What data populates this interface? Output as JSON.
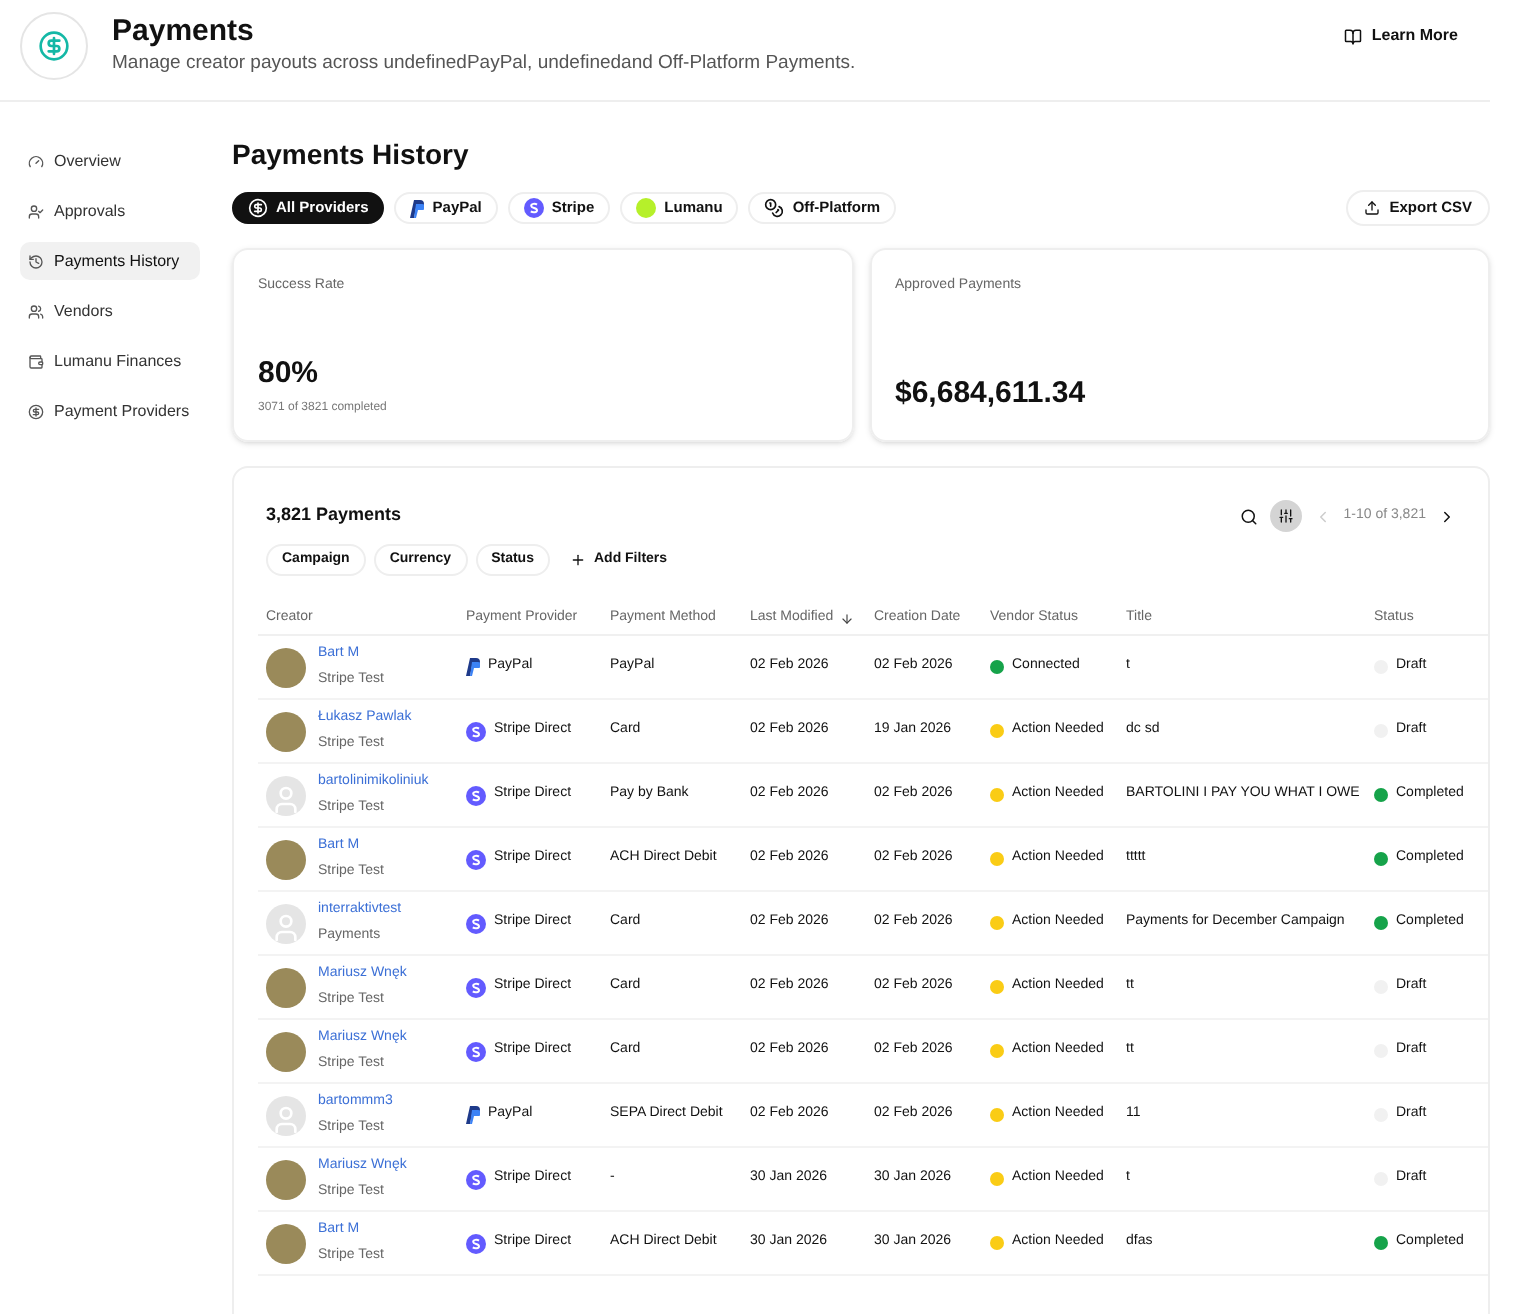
{
  "header": {
    "title": "Payments",
    "subtitle": "Manage creator payouts across undefinedPayPal, undefinedand Off-Platform Payments.",
    "learn_more": "Learn More"
  },
  "sidebar": {
    "items": [
      {
        "label": "Overview",
        "kind": "overview",
        "selected": false
      },
      {
        "label": "Approvals",
        "kind": "approvals",
        "selected": false
      },
      {
        "label": "Payments History",
        "kind": "history",
        "selected": true
      },
      {
        "label": "Vendors",
        "kind": "vendors",
        "selected": false
      },
      {
        "label": "Lumanu Finances",
        "kind": "finances",
        "selected": false
      },
      {
        "label": "Payment Providers",
        "kind": "providers",
        "selected": false
      }
    ]
  },
  "page_title": "Payments History",
  "provider_tabs": [
    {
      "label": "All Providers",
      "kind": "all",
      "selected": true
    },
    {
      "label": "PayPal",
      "kind": "paypal",
      "selected": false
    },
    {
      "label": "Stripe",
      "kind": "stripe",
      "selected": false
    },
    {
      "label": "Lumanu",
      "kind": "lumanu",
      "selected": false
    },
    {
      "label": "Off-Platform",
      "kind": "offplatform",
      "selected": false
    }
  ],
  "export_button": "Export CSV",
  "stats": [
    {
      "label": "Success Rate",
      "value": "80%",
      "note": "3071 of 3821 completed"
    },
    {
      "label": "Approved Payments",
      "value": "$6,684,611.34"
    }
  ],
  "table": {
    "title": "3,821 Payments",
    "filters_active": true,
    "pagination": "1-10 of 3,821",
    "filters": [
      "Campaign",
      "Currency",
      "Status"
    ],
    "add_filters": "Add Filters",
    "columns": [
      "Creator",
      "Payment Provider",
      "Payment Method",
      "Last Modified",
      "Creation Date",
      "Vendor Status",
      "Title",
      "Status"
    ],
    "rows": [
      {
        "avatar": {
          "kind": "photo"
        },
        "name": "Bart M",
        "sub": "Stripe Test",
        "provider": {
          "kind": "paypal",
          "label": "PayPal"
        },
        "method": "PayPal",
        "modified": "02 Feb 2026",
        "created": "02 Feb 2026",
        "vendor_status": {
          "label": "Connected",
          "color": "#16a34a"
        },
        "title": "t",
        "status": {
          "label": "Draft",
          "color": "#f1f1f1"
        }
      },
      {
        "avatar": {
          "kind": "photo"
        },
        "name": "Łukasz Pawlak",
        "sub": "Stripe Test",
        "provider": {
          "kind": "stripe",
          "label": "Stripe Direct"
        },
        "method": "Card",
        "modified": "02 Feb 2026",
        "created": "19 Jan 2026",
        "vendor_status": {
          "label": "Action Needed",
          "color": "#facc15"
        },
        "title": "dc sd",
        "status": {
          "label": "Draft",
          "color": "#f1f1f1"
        }
      },
      {
        "avatar": {
          "kind": "placeholder"
        },
        "name": "bartolinimikoliniuk",
        "sub": "Stripe Test",
        "provider": {
          "kind": "stripe",
          "label": "Stripe Direct"
        },
        "method": "Pay by Bank",
        "modified": "02 Feb 2026",
        "created": "02 Feb 2026",
        "vendor_status": {
          "label": "Action Needed",
          "color": "#facc15"
        },
        "title": "BARTOLINI I PAY YOU WHAT I OWE",
        "status": {
          "label": "Completed",
          "color": "#16a34a"
        }
      },
      {
        "avatar": {
          "kind": "photo"
        },
        "name": "Bart M",
        "sub": "Stripe Test",
        "provider": {
          "kind": "stripe",
          "label": "Stripe Direct"
        },
        "method": "ACH Direct Debit",
        "modified": "02 Feb 2026",
        "created": "02 Feb 2026",
        "vendor_status": {
          "label": "Action Needed",
          "color": "#facc15"
        },
        "title": "ttttt",
        "status": {
          "label": "Completed",
          "color": "#16a34a"
        }
      },
      {
        "avatar": {
          "kind": "placeholder"
        },
        "name": "interraktivtest",
        "sub": "Payments",
        "provider": {
          "kind": "stripe",
          "label": "Stripe Direct"
        },
        "method": "Card",
        "modified": "02 Feb 2026",
        "created": "02 Feb 2026",
        "vendor_status": {
          "label": "Action Needed",
          "color": "#facc15"
        },
        "title": "Payments for December Campaign",
        "status": {
          "label": "Completed",
          "color": "#16a34a"
        }
      },
      {
        "avatar": {
          "kind": "photo"
        },
        "name": "Mariusz Wnęk",
        "sub": "Stripe Test",
        "provider": {
          "kind": "stripe",
          "label": "Stripe Direct"
        },
        "method": "Card",
        "modified": "02 Feb 2026",
        "created": "02 Feb 2026",
        "vendor_status": {
          "label": "Action Needed",
          "color": "#facc15"
        },
        "title": "tt",
        "status": {
          "label": "Draft",
          "color": "#f1f1f1"
        }
      },
      {
        "avatar": {
          "kind": "photo"
        },
        "name": "Mariusz Wnęk",
        "sub": "Stripe Test",
        "provider": {
          "kind": "stripe",
          "label": "Stripe Direct"
        },
        "method": "Card",
        "modified": "02 Feb 2026",
        "created": "02 Feb 2026",
        "vendor_status": {
          "label": "Action Needed",
          "color": "#facc15"
        },
        "title": "tt",
        "status": {
          "label": "Draft",
          "color": "#f1f1f1"
        }
      },
      {
        "avatar": {
          "kind": "placeholder"
        },
        "name": "bartommm3",
        "sub": "Stripe Test",
        "provider": {
          "kind": "paypal",
          "label": "PayPal"
        },
        "method": "SEPA Direct Debit",
        "modified": "02 Feb 2026",
        "created": "02 Feb 2026",
        "vendor_status": {
          "label": "Action Needed",
          "color": "#facc15"
        },
        "title": "11",
        "status": {
          "label": "Draft",
          "color": "#f1f1f1"
        }
      },
      {
        "avatar": {
          "kind": "photo"
        },
        "name": "Mariusz Wnęk",
        "sub": "Stripe Test",
        "provider": {
          "kind": "stripe",
          "label": "Stripe Direct"
        },
        "method": "-",
        "modified": "30 Jan 2026",
        "created": "30 Jan 2026",
        "vendor_status": {
          "label": "Action Needed",
          "color": "#facc15"
        },
        "title": "t",
        "status": {
          "label": "Draft",
          "color": "#f1f1f1"
        }
      },
      {
        "avatar": {
          "kind": "photo"
        },
        "name": "Bart M",
        "sub": "Stripe Test",
        "provider": {
          "kind": "stripe",
          "label": "Stripe Direct"
        },
        "method": "ACH Direct Debit",
        "modified": "30 Jan 2026",
        "created": "30 Jan 2026",
        "vendor_status": {
          "label": "Action Needed",
          "color": "#facc15"
        },
        "title": "dfas",
        "status": {
          "label": "Completed",
          "color": "#16a34a"
        }
      }
    ]
  }
}
